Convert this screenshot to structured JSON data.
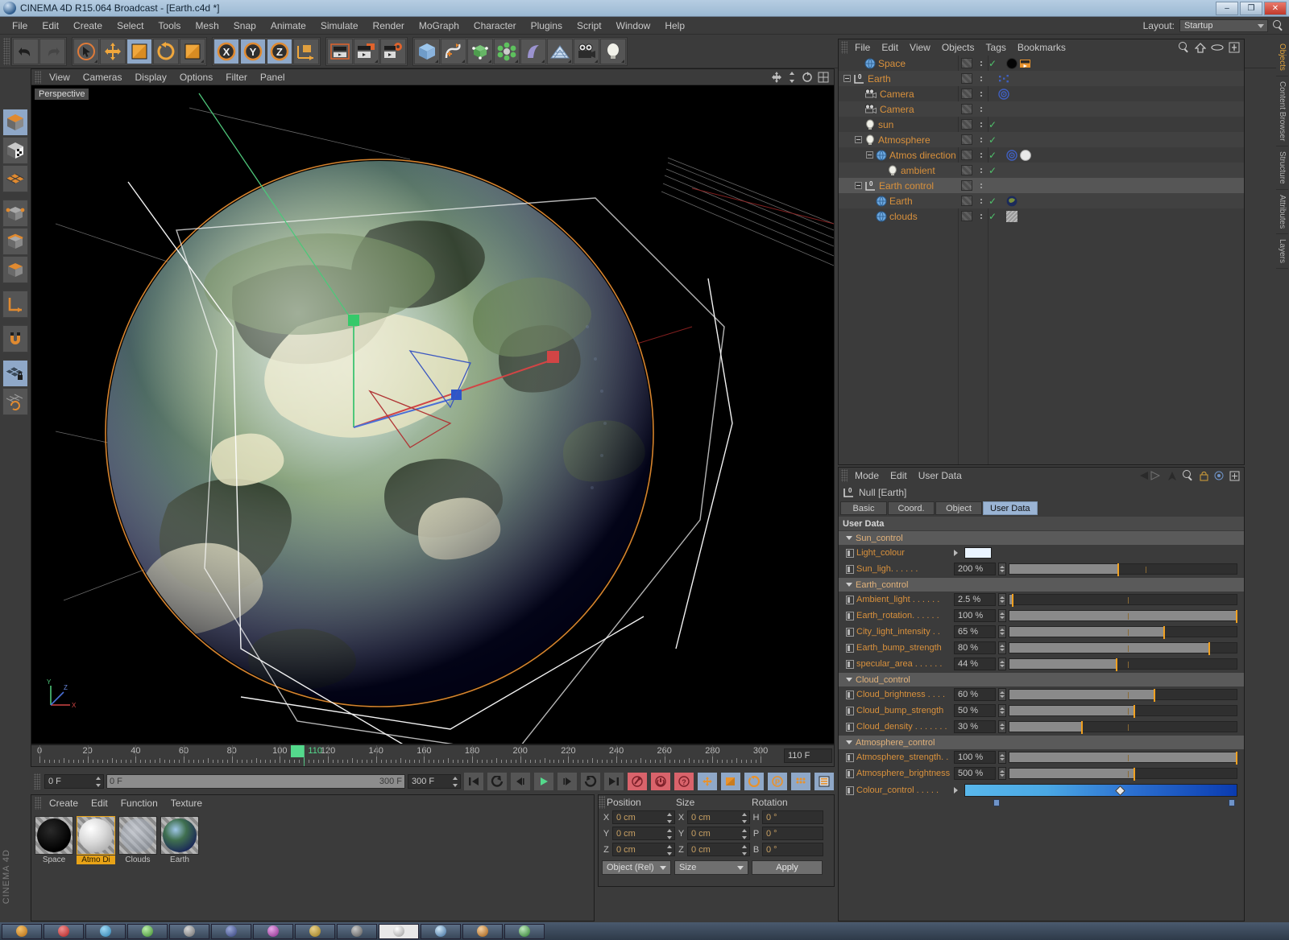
{
  "window": {
    "title": "CINEMA 4D R15.064 Broadcast - [Earth.c4d *]",
    "min_label": "–",
    "max_label": "❐",
    "close_label": "✕"
  },
  "menubar": {
    "items": [
      "File",
      "Edit",
      "Create",
      "Select",
      "Tools",
      "Mesh",
      "Snap",
      "Animate",
      "Simulate",
      "Render",
      "MoGraph",
      "Character",
      "Plugins",
      "Script",
      "Window",
      "Help"
    ],
    "layout_label": "Layout:",
    "layout_value": "Startup"
  },
  "viewport": {
    "menu": [
      "View",
      "Cameras",
      "Display",
      "Options",
      "Filter",
      "Panel"
    ],
    "label": "Perspective",
    "axis_x": "X",
    "axis_y": "Y",
    "axis_z": "Z"
  },
  "timeline": {
    "ticks": [
      0,
      20,
      40,
      60,
      80,
      100,
      120,
      140,
      160,
      180,
      200,
      220,
      240,
      260,
      280,
      300
    ],
    "playhead_frame": 110,
    "playhead_label": "110",
    "current_frame_field": "0 F",
    "range_start": "0 F",
    "range_end": "300 F",
    "doc_end": "300 F",
    "frame_readout": "110 F"
  },
  "materials": {
    "menu": [
      "Create",
      "Edit",
      "Function",
      "Texture"
    ],
    "items": [
      {
        "name": "Space",
        "selected": false
      },
      {
        "name": "Atmo Di",
        "selected": true
      },
      {
        "name": "Clouds",
        "selected": false
      },
      {
        "name": "Earth",
        "selected": false
      }
    ]
  },
  "coordinates": {
    "headers": [
      "Position",
      "Size",
      "Rotation"
    ],
    "rows": [
      {
        "pos_label": "X",
        "pos": "0 cm",
        "size_label": "X",
        "size": "0 cm",
        "rot_label": "H",
        "rot": "0 °"
      },
      {
        "pos_label": "Y",
        "pos": "0 cm",
        "size_label": "Y",
        "size": "0 cm",
        "rot_label": "P",
        "rot": "0 °"
      },
      {
        "pos_label": "Z",
        "pos": "0 cm",
        "size_label": "Z",
        "size": "0 cm",
        "rot_label": "B",
        "rot": "0 °"
      }
    ],
    "mode_select": "Object (Rel)",
    "size_select": "Size",
    "apply_button": "Apply"
  },
  "object_manager": {
    "menu": [
      "File",
      "Edit",
      "View",
      "Objects",
      "Tags",
      "Bookmarks"
    ],
    "rows": [
      {
        "name": "Space",
        "indent": 1,
        "icon": "sphere-icon",
        "expander": false,
        "visible_check": true,
        "tags": [
          "texture-tag-black",
          "sky-tag"
        ]
      },
      {
        "name": "Earth",
        "indent": 0,
        "icon": "null-icon",
        "expander": true,
        "visible_check": false,
        "tags": [
          "xpresso-tag"
        ]
      },
      {
        "name": "Camera",
        "indent": 1,
        "icon": "camera-icon",
        "expander": false,
        "visible_check": false,
        "tags": [
          "target-tag"
        ]
      },
      {
        "name": "Camera",
        "indent": 1,
        "icon": "camera-icon",
        "expander": false,
        "visible_check": false,
        "tags": []
      },
      {
        "name": "sun",
        "indent": 1,
        "icon": "light-icon",
        "expander": false,
        "visible_check": true,
        "tags": []
      },
      {
        "name": "Atmosphere",
        "indent": 1,
        "icon": "light-icon",
        "expander": true,
        "visible_check": true,
        "tags": []
      },
      {
        "name": "Atmos direction",
        "indent": 2,
        "icon": "sphere-icon",
        "expander": true,
        "visible_check": true,
        "tags": [
          "target-tag",
          "texture-tag-white"
        ]
      },
      {
        "name": "ambient",
        "indent": 3,
        "icon": "light-icon",
        "expander": false,
        "visible_check": true,
        "tags": []
      },
      {
        "name": "Earth control",
        "indent": 1,
        "icon": "null-icon",
        "expander": true,
        "visible_check": false,
        "tags": []
      },
      {
        "name": "Earth",
        "indent": 2,
        "icon": "sphere-icon",
        "expander": false,
        "visible_check": true,
        "tags": [
          "texture-tag-earth"
        ]
      },
      {
        "name": "clouds",
        "indent": 2,
        "icon": "sphere-icon",
        "expander": false,
        "visible_check": true,
        "tags": [
          "texture-tag-clouds"
        ]
      }
    ]
  },
  "attributes": {
    "menu": [
      "Mode",
      "Edit",
      "User Data"
    ],
    "object_title": "Null [Earth]",
    "tabs": [
      {
        "label": "Basic",
        "active": false
      },
      {
        "label": "Coord.",
        "active": false
      },
      {
        "label": "Object",
        "active": false
      },
      {
        "label": "User Data",
        "active": true
      }
    ],
    "section_title": "User Data",
    "groups": [
      {
        "name": "Sun_control",
        "params": [
          {
            "label": "Light_colour",
            "type": "color",
            "color": "#eaf4ff"
          },
          {
            "label": "Sun_ligh. . . . . .",
            "type": "slider",
            "value": "200 %",
            "fill_pct": 48,
            "knob_pct": 48,
            "mark_pct": 60
          }
        ]
      },
      {
        "name": "Earth_control",
        "params": [
          {
            "label": "Ambient_light . . . . . .",
            "type": "slider",
            "value": "2.5 %",
            "fill_pct": 1.2,
            "knob_pct": 1.5,
            "mark_pct": 52
          },
          {
            "label": "Earth_rotation. . . . . .",
            "type": "slider",
            "value": "100 %",
            "fill_pct": 100,
            "knob_pct": 100,
            "mark_pct": 52
          },
          {
            "label": "City_light_intensity . .",
            "type": "slider",
            "value": "65 %",
            "fill_pct": 68,
            "knob_pct": 68,
            "mark_pct": 52
          },
          {
            "label": "Earth_bump_strength",
            "type": "slider",
            "value": "80 %",
            "fill_pct": 88,
            "knob_pct": 88,
            "mark_pct": 52
          },
          {
            "label": "specular_area . . . . . .",
            "type": "slider",
            "value": "44 %",
            "fill_pct": 47,
            "knob_pct": 47,
            "mark_pct": 52
          }
        ]
      },
      {
        "name": "Cloud_control",
        "params": [
          {
            "label": "Cloud_brightness . . . .",
            "type": "slider",
            "value": "60 %",
            "fill_pct": 64,
            "knob_pct": 64,
            "mark_pct": 52
          },
          {
            "label": "Cloud_bump_strength",
            "type": "slider",
            "value": "50 %",
            "fill_pct": 55,
            "knob_pct": 55,
            "mark_pct": 52
          },
          {
            "label": "Cloud_density . . . . . . .",
            "type": "slider",
            "value": "30 %",
            "fill_pct": 32,
            "knob_pct": 32,
            "mark_pct": 52
          }
        ]
      },
      {
        "name": "Atmosphere_control",
        "params": [
          {
            "label": "Atmosphere_strength. .",
            "type": "slider",
            "value": "100 %",
            "fill_pct": 100,
            "knob_pct": 100,
            "mark_pct": 52
          },
          {
            "label": "Atmosphere_brightness",
            "type": "slider",
            "value": "500 %",
            "fill_pct": 55,
            "knob_pct": 55,
            "mark_pct": 52
          },
          {
            "label": "Colour_control . . . . .",
            "type": "gradient",
            "knob_pct": 57,
            "stop_pct": 12,
            "stop2_pct": 99
          }
        ]
      }
    ]
  },
  "right_tabs": [
    {
      "label": "Objects",
      "active": true
    },
    {
      "label": "Content Browser",
      "active": false
    },
    {
      "label": "Structure",
      "active": false
    },
    {
      "label": "Attributes",
      "active": false
    },
    {
      "label": "Layers",
      "active": false
    }
  ],
  "left_tools": [
    {
      "name": "model-mode-icon",
      "active": true
    },
    {
      "name": "texture-mode-icon",
      "active": false
    },
    {
      "name": "points-mode-icon",
      "active": false
    },
    {
      "name": "point-mode-icon",
      "active": false
    },
    {
      "name": "edge-mode-icon",
      "active": false
    },
    {
      "name": "polygon-mode-icon",
      "active": false
    },
    {
      "name": "axis-mode-icon",
      "active": false
    },
    {
      "name": "enable-snap-icon",
      "active": false
    },
    {
      "name": "workplane-lock-icon",
      "active": true
    },
    {
      "name": "workplane-icon",
      "active": false
    }
  ],
  "brand": "CINEMA 4D"
}
